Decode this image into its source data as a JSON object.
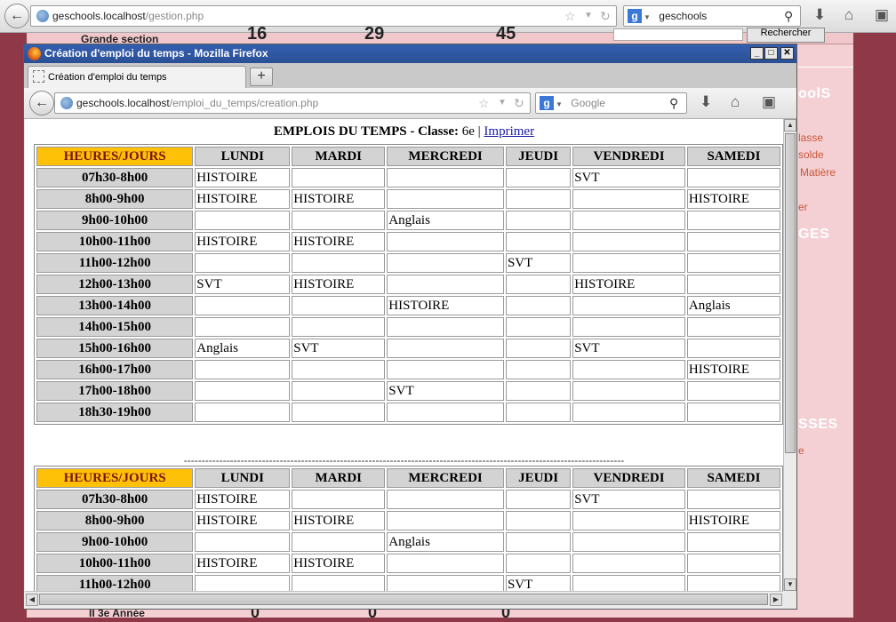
{
  "bg_browser": {
    "url_host": "geschools.localhost",
    "url_path": "/gestion.php",
    "search_value": "geschools",
    "search_button": "Rechercher",
    "top_strip": {
      "label": "Grande section",
      "values": [
        "16",
        "29",
        "45"
      ]
    },
    "bottom_strip": {
      "label": "II 3e Année",
      "values": [
        "0",
        "0",
        "0"
      ]
    },
    "sidebar_heads": [
      "oolS",
      "GES",
      "SSES"
    ],
    "sidebar_links": [
      "lasse",
      "solde",
      "Matière",
      "er",
      "e"
    ]
  },
  "popup": {
    "window_title": "Création d'emploi du temps - Mozilla Firefox",
    "tab_label": "Création d'emploi du temps",
    "url_host": "geschools.localhost",
    "url_path": "/emploi_du_temps/creation.php",
    "search_placeholder": "Google",
    "page": {
      "heading": "EMPLOIS DU TEMPS",
      "class_label": "Classe:",
      "class_value": "6e",
      "separator": "|",
      "print_link": "Imprimer",
      "divider": "----------------------------------------------------------------------------------------------------------------------------"
    },
    "timetable": {
      "corner": "HEURES/JOURS",
      "days": [
        "LUNDI",
        "MARDI",
        "MERCREDI",
        "JEUDI",
        "VENDREDI",
        "SAMEDI"
      ],
      "rows": [
        {
          "hour": "07h30-8h00",
          "cells": [
            "HISTOIRE",
            "",
            "",
            "",
            "SVT",
            ""
          ]
        },
        {
          "hour": "8h00-9h00",
          "cells": [
            "HISTOIRE",
            "HISTOIRE",
            "",
            "",
            "",
            "HISTOIRE"
          ]
        },
        {
          "hour": "9h00-10h00",
          "cells": [
            "",
            "",
            "Anglais",
            "",
            "",
            ""
          ]
        },
        {
          "hour": "10h00-11h00",
          "cells": [
            "HISTOIRE",
            "HISTOIRE",
            "",
            "",
            "",
            ""
          ]
        },
        {
          "hour": "11h00-12h00",
          "cells": [
            "",
            "",
            "",
            "SVT",
            "",
            ""
          ]
        },
        {
          "hour": "12h00-13h00",
          "cells": [
            "SVT",
            "HISTOIRE",
            "",
            "",
            "HISTOIRE",
            ""
          ]
        },
        {
          "hour": "13h00-14h00",
          "cells": [
            "",
            "",
            "HISTOIRE",
            "",
            "",
            "Anglais"
          ]
        },
        {
          "hour": "14h00-15h00",
          "cells": [
            "",
            "",
            "",
            "",
            "",
            ""
          ]
        },
        {
          "hour": "15h00-16h00",
          "cells": [
            "Anglais",
            "SVT",
            "",
            "",
            "SVT",
            ""
          ]
        },
        {
          "hour": "16h00-17h00",
          "cells": [
            "",
            "",
            "",
            "",
            "",
            "HISTOIRE"
          ]
        },
        {
          "hour": "17h00-18h00",
          "cells": [
            "",
            "",
            "SVT",
            "",
            "",
            ""
          ]
        },
        {
          "hour": "18h30-19h00",
          "cells": [
            "",
            "",
            "",
            "",
            "",
            ""
          ]
        }
      ],
      "second_rows": [
        {
          "hour": "07h30-8h00",
          "cells": [
            "HISTOIRE",
            "",
            "",
            "",
            "SVT",
            ""
          ]
        },
        {
          "hour": "8h00-9h00",
          "cells": [
            "HISTOIRE",
            "HISTOIRE",
            "",
            "",
            "",
            "HISTOIRE"
          ]
        },
        {
          "hour": "9h00-10h00",
          "cells": [
            "",
            "",
            "Anglais",
            "",
            "",
            ""
          ]
        },
        {
          "hour": "10h00-11h00",
          "cells": [
            "HISTOIRE",
            "HISTOIRE",
            "",
            "",
            "",
            ""
          ]
        },
        {
          "hour": "11h00-12h00",
          "cells": [
            "",
            "",
            "",
            "SVT",
            "",
            ""
          ]
        }
      ]
    }
  }
}
